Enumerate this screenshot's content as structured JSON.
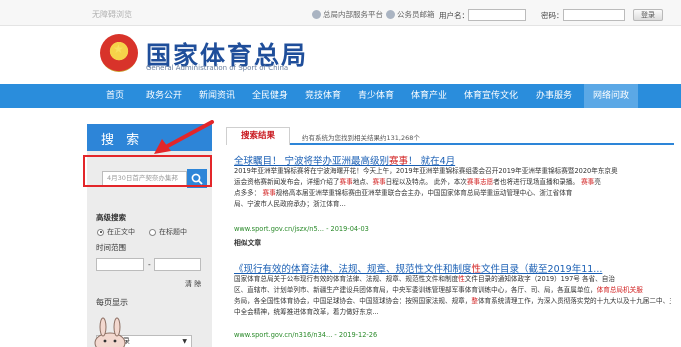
{
  "topbar": {
    "accessibility": "无障碍浏览",
    "internal_platform": "总局内部服务平台",
    "public_mail": "公务员邮箱",
    "username_label": "用户名：",
    "password_label": "密码：",
    "login_button": "登录"
  },
  "brand": {
    "title": "国家体育总局",
    "subtitle": "General Administration of Sport of China"
  },
  "nav": {
    "items": [
      "首页",
      "政务公开",
      "新闻资讯",
      "全民健身",
      "竞技体育",
      "青少体育",
      "体育产业",
      "体育宣传文化",
      "办事服务",
      "网络问政"
    ],
    "active_index": 9
  },
  "search_panel": {
    "heading": "搜 索",
    "query": "4月30日首产契奈办集邦",
    "advanced_label": "高级搜索",
    "scope_options": [
      "在正文中",
      "在标题中"
    ],
    "scope_selected": 0,
    "time_range_label": "时间范围",
    "date_separator": "-",
    "clear_label": "清 除",
    "per_page_label": "每页显示",
    "per_page_value": "10条记录"
  },
  "results": {
    "tab_label": "搜索结果",
    "count_text": "约有系统为您找到相关结果约131,268个",
    "items": [
      {
        "title_parts": [
          {
            "t": "全球瞩目！ 宁波将举办亚洲最高级别",
            "hl": false
          },
          {
            "t": "赛事",
            "hl": true
          },
          {
            "t": "！ 就在4月",
            "hl": false
          }
        ],
        "snippet": [
          [
            {
              "t": "2019年亚洲举重锦标赛将在宁波海曙开花！今天上午，2019年亚洲举重锦标赛组委会召开2019年亚洲举重锦标赛暨2020年东京奥",
              "hl": false
            }
          ],
          [
            {
              "t": "运会资格赛新闻发布会，详细介绍了",
              "hl": false
            },
            {
              "t": "赛事",
              "hl": true
            },
            {
              "t": "地点、",
              "hl": false
            },
            {
              "t": "赛事",
              "hl": true
            },
            {
              "t": "日程以及特点。 此外，本次",
              "hl": false
            },
            {
              "t": "赛事志愿",
              "hl": true
            },
            {
              "t": "者也将进行现场直播和录播。 ",
              "hl": false
            },
            {
              "t": "赛事",
              "hl": true
            },
            {
              "t": "亮",
              "hl": false
            }
          ],
          [
            {
              "t": "点多多： ",
              "hl": false
            },
            {
              "t": "赛事",
              "hl": true
            },
            {
              "t": "规格高本届亚洲举重锦标赛由亚洲举重联合会主办，中国国家体育总局举重运动管理中心、浙江省体育",
              "hl": false
            }
          ],
          [
            {
              "t": "局、宁波市人民政府承办；浙江体育...",
              "hl": false
            }
          ]
        ],
        "url": "www.sport.gov.cn/jszx/n5...",
        "date": "2019-04-03",
        "related": "相似文章"
      },
      {
        "title_parts": [
          {
            "t": "《现行有效的体育法律、法规、规章、规范性文件和制度",
            "hl": false
          },
          {
            "t": "性",
            "hl": true
          },
          {
            "t": "文件目录（截至2019年11...",
            "hl": false
          }
        ],
        "snippet": [
          [
            {
              "t": "国家体育总局关于公布现行有效的体育法律、法规、规章、规范性文件和制度",
              "hl": false
            },
            {
              "t": "性",
              "hl": true
            },
            {
              "t": "文件目录的通知体政字（2019）197号 各省、自治",
              "hl": false
            }
          ],
          [
            {
              "t": "区、直辖市、计划单列市、新疆生产建设兵团体育局，中央军委训练管理部军事体育训练中心，各厅、司、局，各直属单位，",
              "hl": false
            },
            {
              "t": "体育总局机关服",
              "hl": true
            }
          ],
          [
            {
              "t": "务局，各全国性体育协会，中国足球协会、中国篮球协会：按照国家法规、规章，",
              "hl": false
            },
            {
              "t": "整",
              "hl": true
            },
            {
              "t": "体育系统清理工作，为深入贯彻落实党的十九大以及十九届二中、三中、四",
              "hl": false
            }
          ],
          [
            {
              "t": "中全会精神，统筹推进体育改革，着力做好东京...",
              "hl": false
            }
          ]
        ],
        "url": "www.sport.gov.cn/n316/n34...",
        "date": "2019-12-26"
      }
    ]
  },
  "colors": {
    "nav_blue": "#2a8ddc",
    "brand_blue": "#1f4e9a",
    "highlight_red": "#d11e1e",
    "annotation_red": "#e3262a",
    "url_green": "#2a8a2a"
  }
}
